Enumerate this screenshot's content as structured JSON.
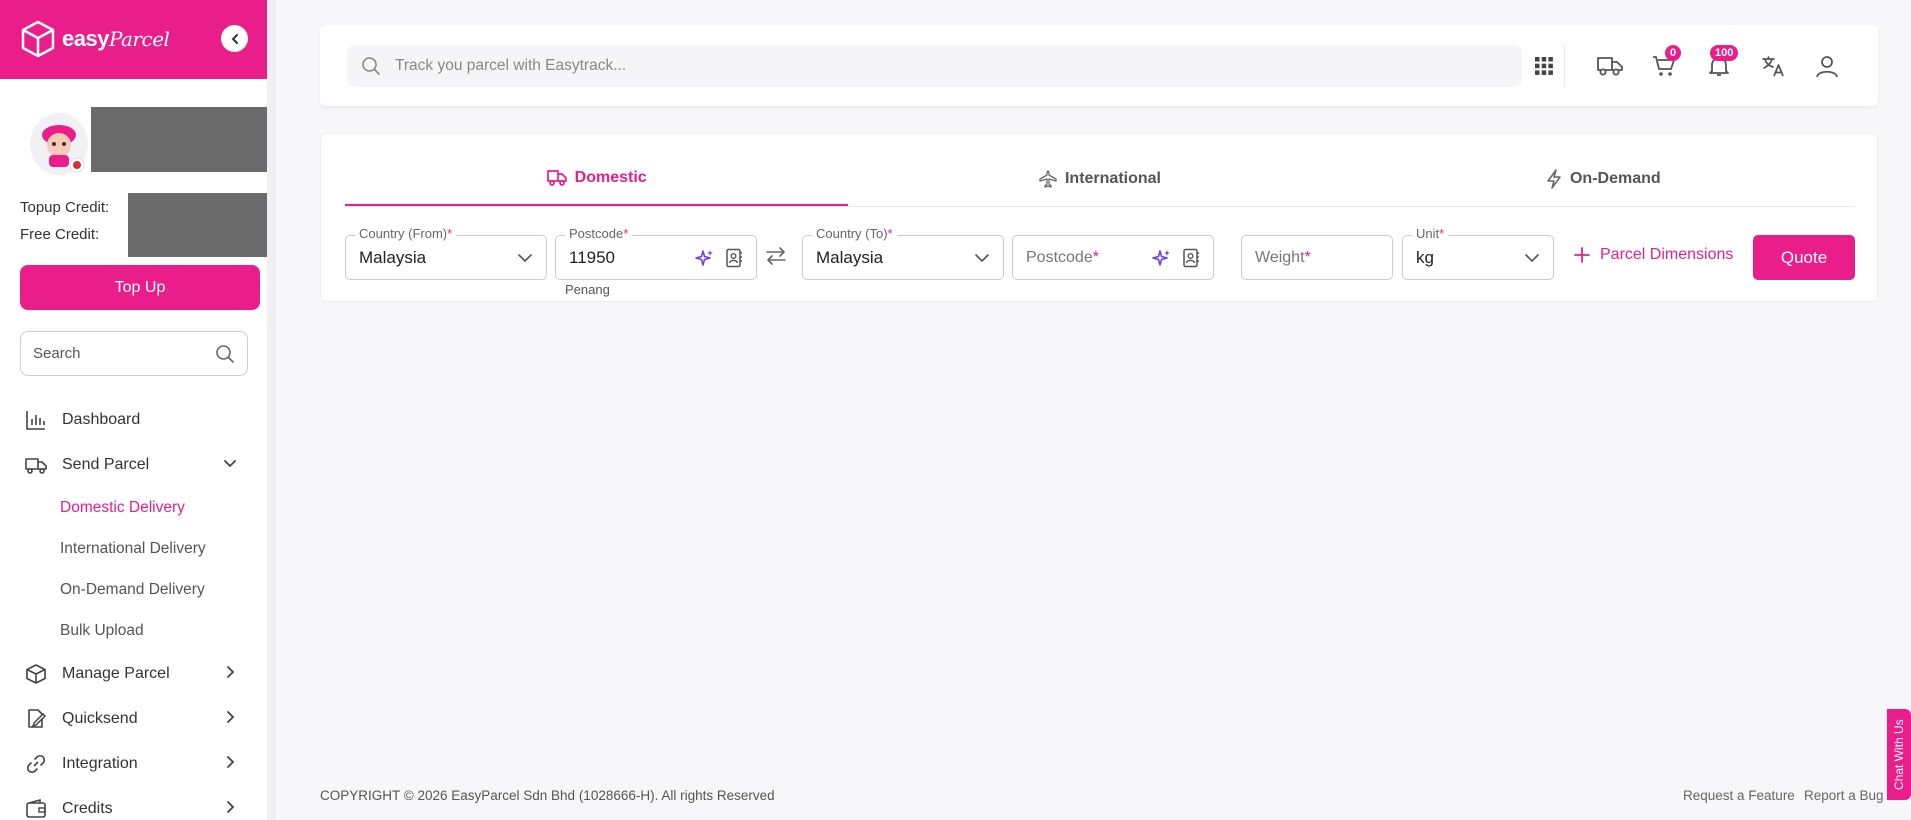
{
  "brand": {
    "name_bold": "easy",
    "name_script": "Parcel",
    "accent": "#ea1e8b"
  },
  "profile": {
    "topup_label": "Topup Credit:",
    "free_label": "Free Credit:",
    "topup_button": "Top Up"
  },
  "sidebar_search": {
    "placeholder": "Search"
  },
  "nav": {
    "dashboard": "Dashboard",
    "send_parcel": "Send Parcel",
    "sub": {
      "domestic": "Domestic Delivery",
      "international": "International Delivery",
      "on_demand": "On-Demand Delivery",
      "bulk": "Bulk Upload"
    },
    "manage_parcel": "Manage Parcel",
    "quicksend": "Quicksend",
    "integration": "Integration",
    "credits": "Credits"
  },
  "topbar": {
    "track_placeholder": "Track you parcel with Easytrack...",
    "cart_count": "0",
    "notif_count": "100"
  },
  "tabs": {
    "domestic": "Domestic",
    "international": "International",
    "on_demand": "On-Demand"
  },
  "form": {
    "country_from_label": "Country (From)",
    "country_from_value": "Malaysia",
    "postcode_label": "Postcode",
    "postcode_from_value": "11950",
    "postcode_from_area": "Penang",
    "country_to_label": "Country (To)",
    "country_to_value": "Malaysia",
    "postcode_to_placeholder": "Postcode",
    "weight_placeholder": "Weight",
    "unit_label": "Unit",
    "unit_value": "kg",
    "required_mark": "*",
    "dimensions_label": "Parcel Dimensions",
    "quote_button": "Quote"
  },
  "footer": {
    "copyright": "COPYRIGHT © 2026 EasyParcel Sdn Bhd (1028666-H). All rights Reserved",
    "request_feature": "Request a Feature",
    "report_bug": "Report a Bug",
    "chat": "Chat With Us"
  }
}
